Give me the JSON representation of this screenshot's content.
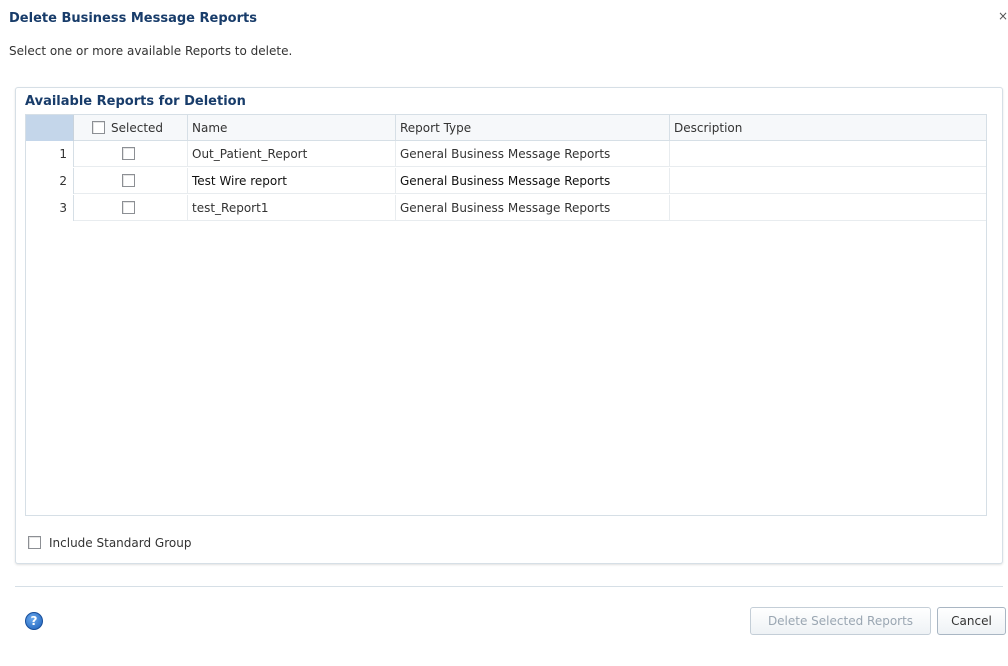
{
  "dialog": {
    "title": "Delete Business Message Reports",
    "close_glyph": "×",
    "instructions": "Select one or more available Reports to delete."
  },
  "panel": {
    "title": "Available Reports for Deletion"
  },
  "table": {
    "columns": {
      "selected": "Selected",
      "name": "Name",
      "report_type": "Report Type",
      "description": "Description"
    },
    "rows": [
      {
        "num": "1",
        "name": "Out_Patient_Report",
        "type": "General Business Message Reports",
        "description": ""
      },
      {
        "num": "2",
        "name": "Test Wire report",
        "type": "General Business Message Reports",
        "description": ""
      },
      {
        "num": "3",
        "name": "test_Report1",
        "type": "General Business Message Reports",
        "description": ""
      }
    ]
  },
  "include_standard_group": {
    "label": "Include Standard Group"
  },
  "footer": {
    "help_icon": "?",
    "delete_label": "Delete Selected Reports",
    "cancel_label": "Cancel"
  },
  "colors": {
    "title": "#183c6a",
    "grid_border": "#d6dfe6",
    "corner": "#c4d6ea",
    "help_icon": "#1b5eb8"
  }
}
